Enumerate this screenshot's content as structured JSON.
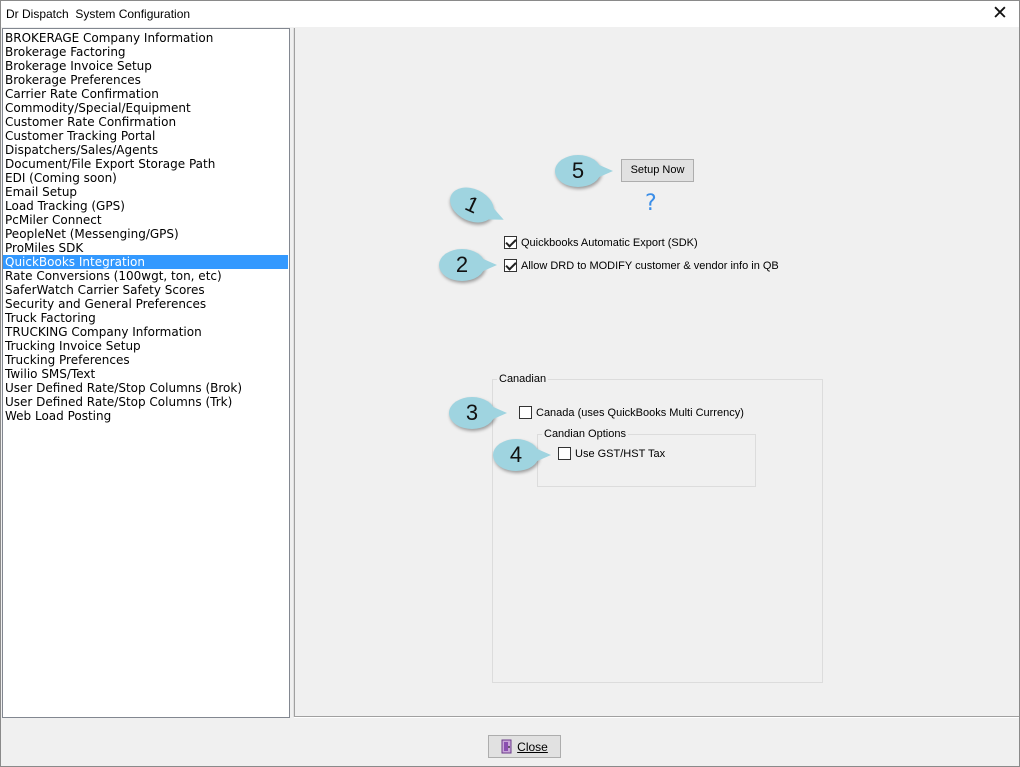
{
  "window": {
    "title": "Dr Dispatch  System Configuration",
    "close_glyph": "✕"
  },
  "sidebar": {
    "items": [
      "BROKERAGE Company Information",
      "Brokerage Factoring",
      "Brokerage Invoice Setup",
      "Brokerage Preferences",
      "Carrier Rate Confirmation",
      "Commodity/Special/Equipment",
      "Customer Rate Confirmation",
      "Customer Tracking Portal",
      "Dispatchers/Sales/Agents",
      "Document/File Export Storage Path",
      "EDI (Coming soon)",
      "Email Setup",
      "Load Tracking (GPS)",
      "PcMiler Connect",
      "PeopleNet (Messenging/GPS)",
      "ProMiles SDK",
      "QuickBooks Integration",
      "Rate Conversions (100wgt, ton, etc)",
      "SaferWatch Carrier Safety Scores",
      "Security and General Preferences",
      "Truck Factoring",
      "TRUCKING Company Information",
      "Trucking Invoice Setup",
      "Trucking Preferences",
      "Twilio SMS/Text",
      "User Defined Rate/Stop Columns (Brok)",
      "User Defined Rate/Stop Columns (Trk)",
      "Web Load Posting"
    ],
    "selected_index": 16
  },
  "quickbooks": {
    "setup_now_label": "Setup Now",
    "help_glyph": "?",
    "auto_export_label": "Quickbooks Automatic Export (SDK)",
    "auto_export_checked": true,
    "modify_label": "Allow DRD to MODIFY customer & vendor info in QB",
    "modify_checked": true
  },
  "canadian": {
    "group_label": "Canadian",
    "canada_label": "Canada (uses QuickBooks Multi Currency)",
    "canada_checked": false,
    "options_group_label": "Candian Options",
    "gst_label": "Use GST/HST Tax",
    "gst_checked": false
  },
  "callouts": {
    "c1": "1",
    "c2": "2",
    "c3": "3",
    "c4": "4",
    "c5": "5"
  },
  "footer": {
    "close_label": "Close"
  },
  "colors": {
    "selection": "#3399ff",
    "callout": "#9fd4e0",
    "help": "#3b8ee8"
  }
}
